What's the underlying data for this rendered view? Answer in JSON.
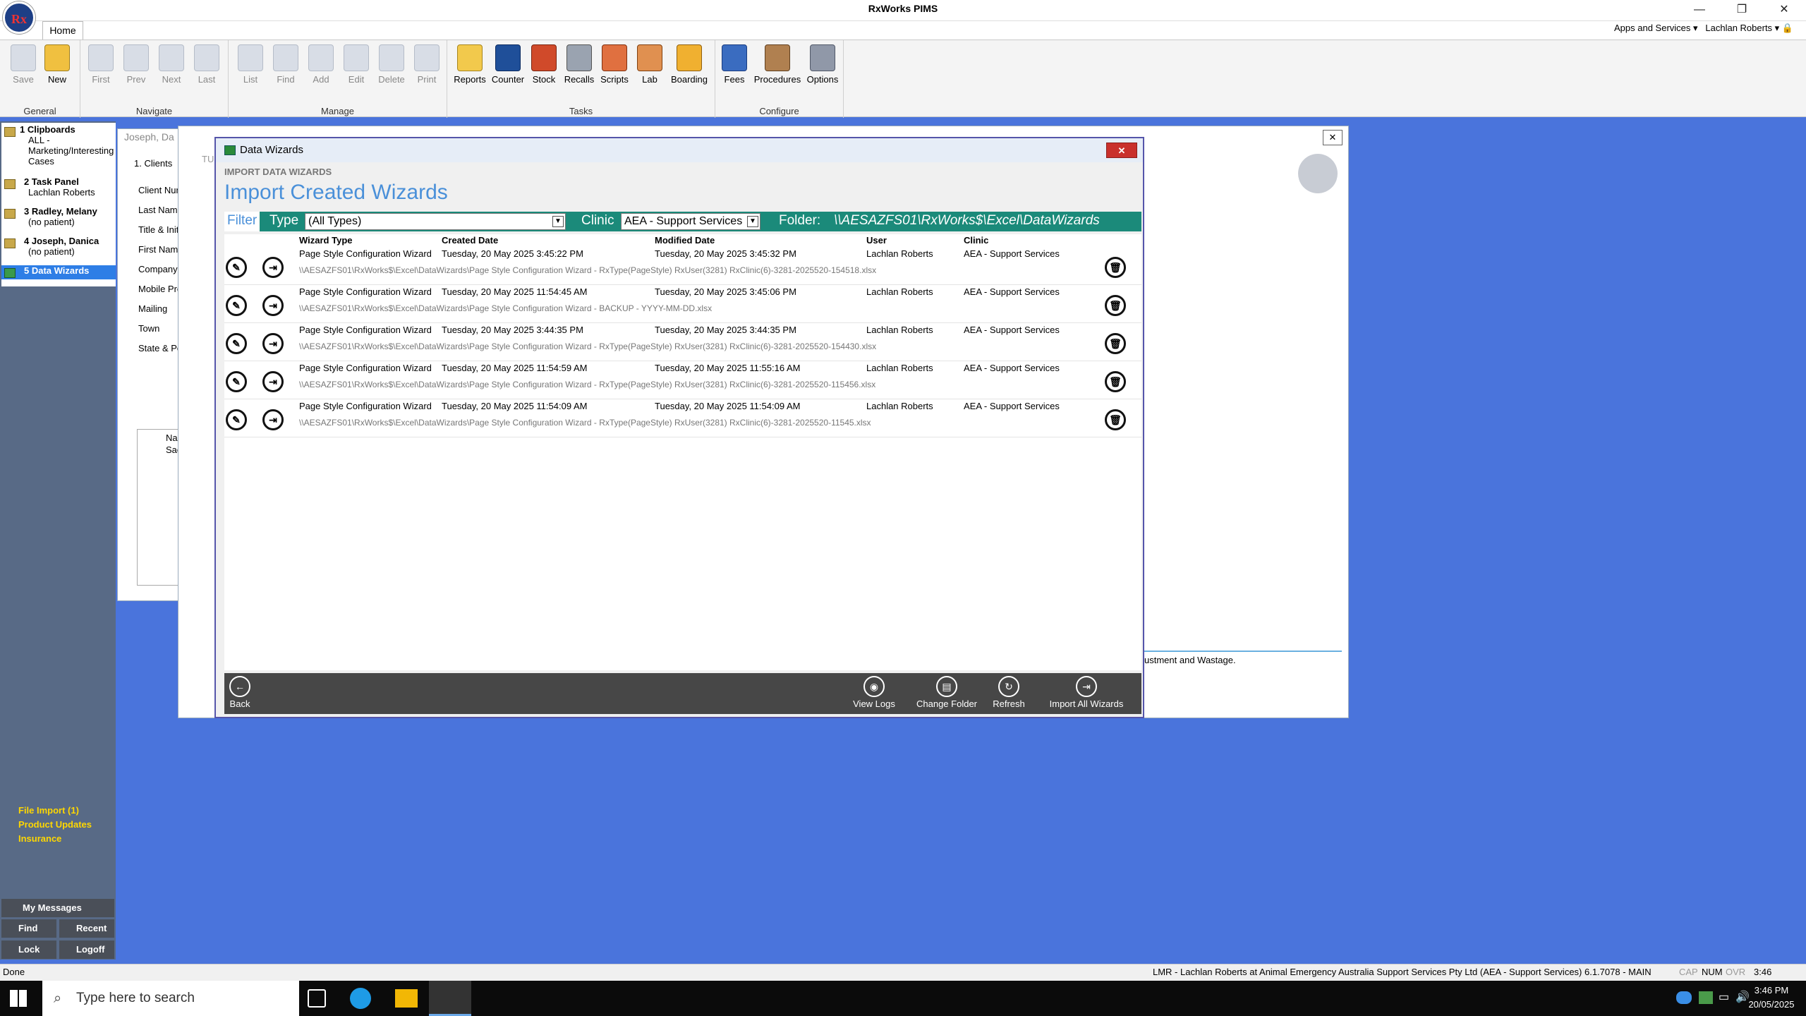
{
  "app": {
    "title": "RxWorks PIMS",
    "logo_text": "Rx"
  },
  "window_controls": {
    "minimize": "—",
    "restore": "❐",
    "close": "✕"
  },
  "menu": {
    "home_tab": "Home",
    "apps_services": "Apps and Services",
    "user": "Lachlan Roberts"
  },
  "ribbon": {
    "groups": [
      "General",
      "Navigate",
      "Manage",
      "Tasks",
      "Configure"
    ],
    "general": [
      "Save",
      "New"
    ],
    "navigate": [
      "First",
      "Prev",
      "Next",
      "Last"
    ],
    "manage": [
      "List",
      "Find",
      "Add",
      "Edit",
      "Delete",
      "Print"
    ],
    "tasks": [
      "Reports",
      "Counter",
      "Stock",
      "Recalls",
      "Scripts",
      "Lab",
      "Boarding"
    ],
    "configure": [
      "Fees",
      "Procedures",
      "Options"
    ]
  },
  "sidebar": {
    "items": [
      {
        "num": "1",
        "title": "Clipboards",
        "sub1": "ALL -",
        "sub2": "Marketing/Interesting",
        "sub3": "Cases"
      },
      {
        "num": "2",
        "title": "Task Panel",
        "sub1": "Lachlan Roberts"
      },
      {
        "num": "3",
        "title": "Radley, Melany",
        "sub1": "(no patient)"
      },
      {
        "num": "4",
        "title": "Joseph, Danica",
        "sub1": "(no patient)"
      },
      {
        "num": "5",
        "title": "Data Wizards"
      }
    ],
    "links": [
      "File Import (1)",
      "Product Updates",
      "Insurance"
    ],
    "my_messages": "My Messages",
    "find": "Find",
    "recent": "Recent",
    "lock": "Lock",
    "logoff": "Logoff"
  },
  "background_client": {
    "window_title": "Joseph, Da",
    "tab": "1. Clients",
    "fields": [
      "Client Numbe",
      "Last Name",
      "Title & Initials",
      "First Names",
      "Company",
      "Mobile Prefe",
      "Mailing",
      "Town",
      "State & Posto"
    ],
    "list_header": "Name",
    "list_value": "Saoirs",
    "partial_text": "ustment and Wastage.",
    "partial_label": "TU"
  },
  "dialog": {
    "title": "Data Wizards",
    "subheading": "IMPORT DATA WIZARDS",
    "heading": "Import Created Wizards",
    "filter_label": "Filter",
    "type_label": "Type",
    "type_value": "(All Types)",
    "clinic_label": "Clinic",
    "clinic_value": "AEA - Support Services",
    "folder_label": "Folder:",
    "folder_value": "\\\\AESAZFS01\\RxWorks$\\Excel\\DataWizards",
    "columns": [
      "Wizard Type",
      "Created Date",
      "Modified Date",
      "User",
      "Clinic"
    ],
    "rows": [
      {
        "type": "Page Style Configuration Wizard",
        "created": "Tuesday, 20 May 2025 3:45:22 PM",
        "modified": "Tuesday, 20 May 2025 3:45:32 PM",
        "user": "Lachlan Roberts",
        "clinic": "AEA - Support Services",
        "path": "\\\\AESAZFS01\\RxWorks$\\Excel\\DataWizards\\Page Style Configuration Wizard - RxType(PageStyle) RxUser(3281) RxClinic(6)-3281-2025520-154518.xlsx"
      },
      {
        "type": "Page Style Configuration Wizard",
        "created": "Tuesday, 20 May 2025 11:54:45 AM",
        "modified": "Tuesday, 20 May 2025 3:45:06 PM",
        "user": "Lachlan Roberts",
        "clinic": "AEA - Support Services",
        "path": "\\\\AESAZFS01\\RxWorks$\\Excel\\DataWizards\\Page Style Configuration Wizard - BACKUP - YYYY-MM-DD.xlsx"
      },
      {
        "type": "Page Style Configuration Wizard",
        "created": "Tuesday, 20 May 2025 3:44:35 PM",
        "modified": "Tuesday, 20 May 2025 3:44:35 PM",
        "user": "Lachlan Roberts",
        "clinic": "AEA - Support Services",
        "path": "\\\\AESAZFS01\\RxWorks$\\Excel\\DataWizards\\Page Style Configuration Wizard - RxType(PageStyle) RxUser(3281) RxClinic(6)-3281-2025520-154430.xlsx"
      },
      {
        "type": "Page Style Configuration Wizard",
        "created": "Tuesday, 20 May 2025 11:54:59 AM",
        "modified": "Tuesday, 20 May 2025 11:55:16 AM",
        "user": "Lachlan Roberts",
        "clinic": "AEA - Support Services",
        "path": "\\\\AESAZFS01\\RxWorks$\\Excel\\DataWizards\\Page Style Configuration Wizard - RxType(PageStyle) RxUser(3281) RxClinic(6)-3281-2025520-115456.xlsx"
      },
      {
        "type": "Page Style Configuration Wizard",
        "created": "Tuesday, 20 May 2025 11:54:09 AM",
        "modified": "Tuesday, 20 May 2025 11:54:09 AM",
        "user": "Lachlan Roberts",
        "clinic": "AEA - Support Services",
        "path": "\\\\AESAZFS01\\RxWorks$\\Excel\\DataWizards\\Page Style Configuration Wizard - RxType(PageStyle) RxUser(3281) RxClinic(6)-3281-2025520-11545.xlsx"
      }
    ],
    "footer": {
      "back": "Back",
      "view_logs": "View Logs",
      "change_folder": "Change Folder",
      "refresh": "Refresh",
      "import_all": "Import All Wizards"
    }
  },
  "status": {
    "left": "Done",
    "right": "LMR - Lachlan Roberts at Animal Emergency Australia Support Services Pty Ltd (AEA - Support Services) 6.1.7078 - MAIN",
    "caps": "CAP",
    "num": "NUM",
    "ovr": "OVR",
    "time": "3:46"
  },
  "taskbar": {
    "search_placeholder": "Type here to search",
    "time": "3:46 PM",
    "date": "20/05/2025"
  },
  "colors": {
    "desktop": "#4a74dc",
    "filter_bar": "#1b8a7a",
    "heading": "#4a90d9",
    "selected": "#2e7ee6",
    "links": "#ffd700"
  }
}
